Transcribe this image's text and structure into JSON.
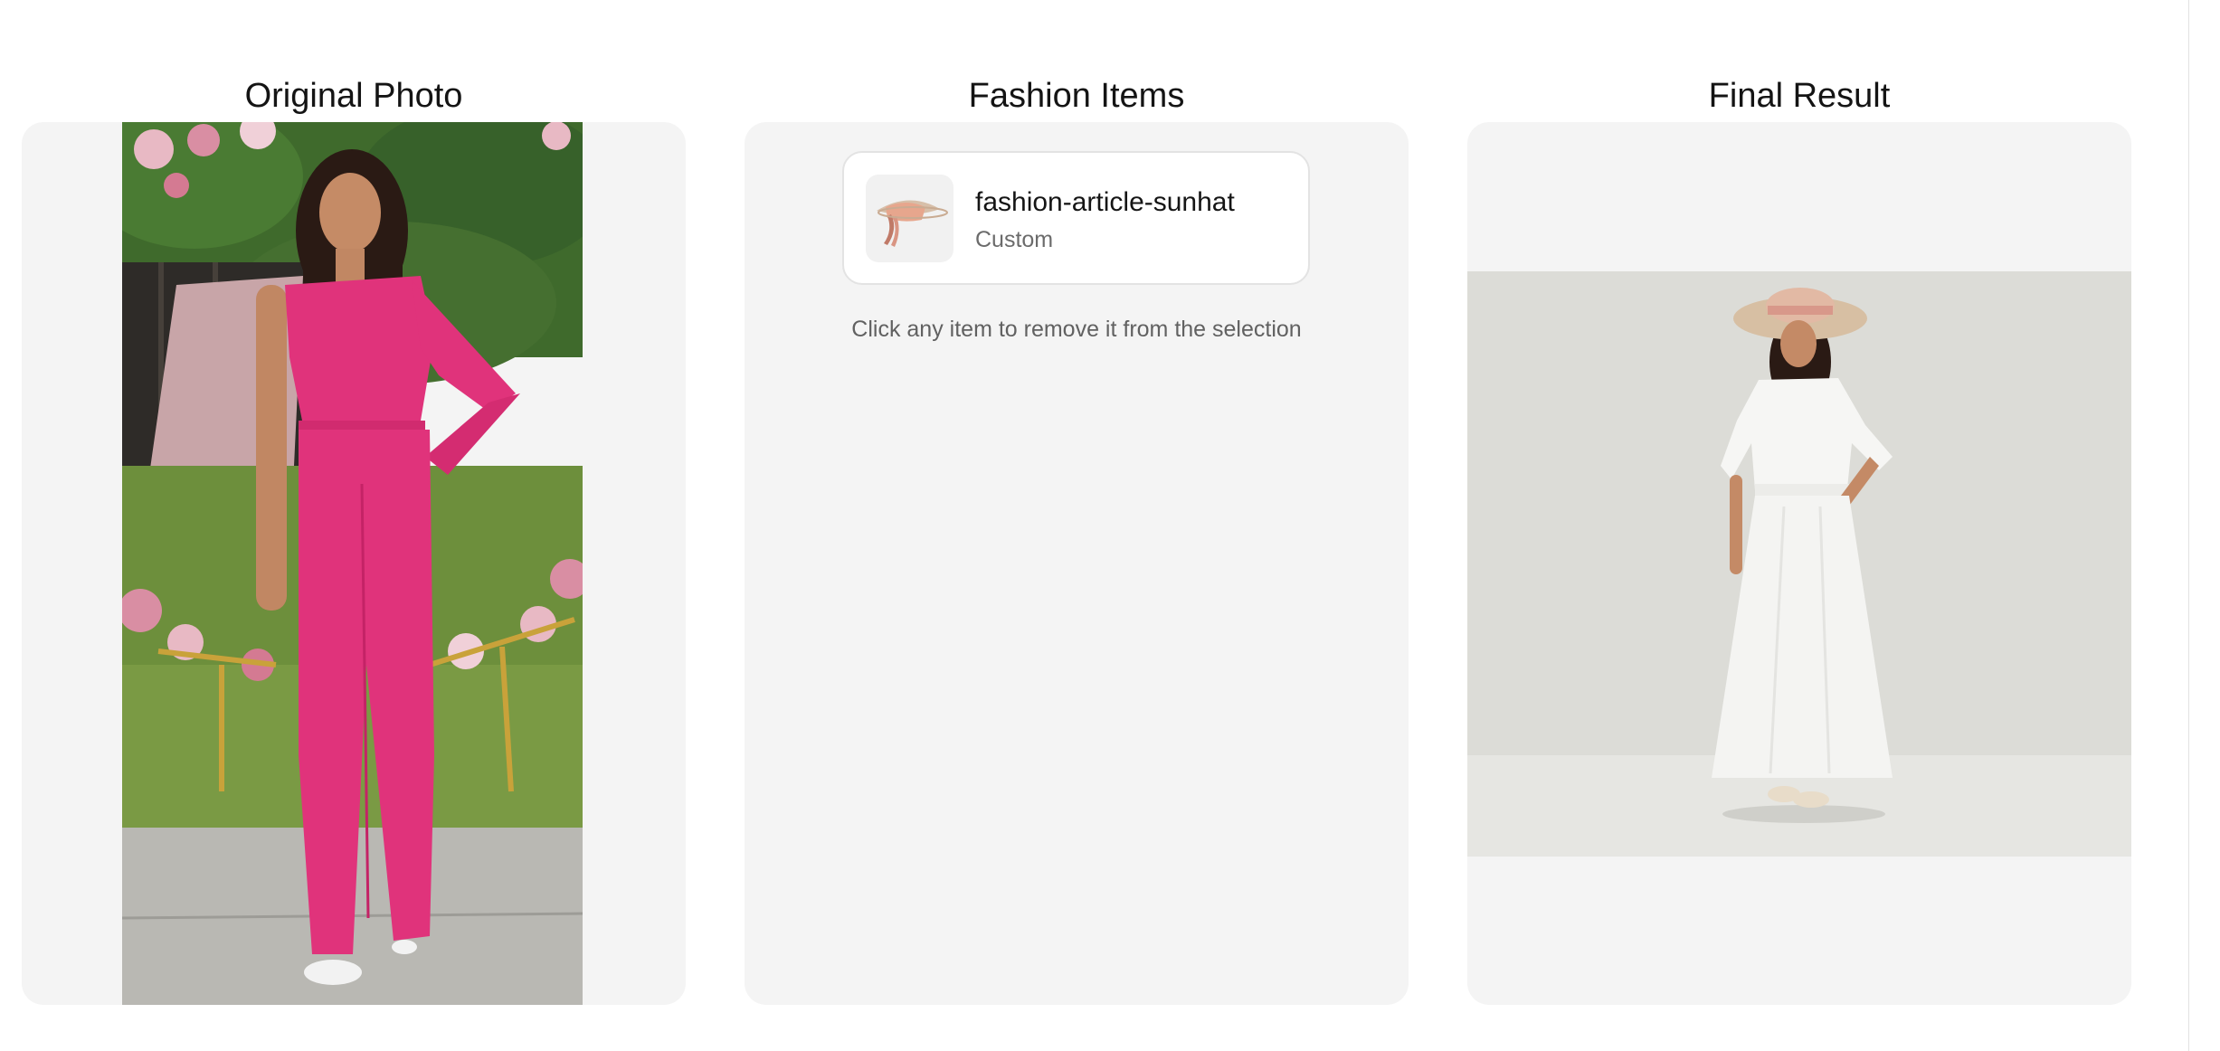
{
  "columns": {
    "original": {
      "title": "Original Photo"
    },
    "items": {
      "title": "Fashion Items"
    },
    "result": {
      "title": "Final Result"
    }
  },
  "fashion_items": [
    {
      "name": "fashion-article-sunhat",
      "type": "Custom",
      "icon": "sunhat-thumbnail"
    }
  ],
  "items_hint": "Click any item to remove it from the selection",
  "colors": {
    "panel_bg": "#f4f4f4",
    "card_border": "#e3e3e3",
    "jumpsuit": "#e0337b",
    "dress": "#f4f4f2"
  }
}
